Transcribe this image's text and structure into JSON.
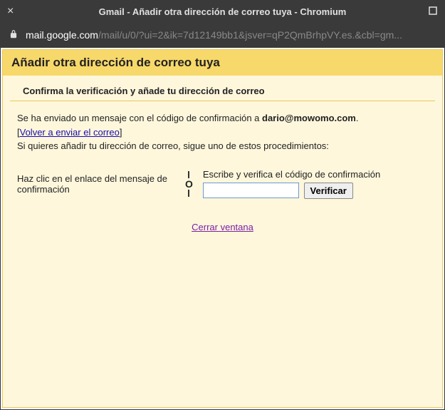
{
  "window": {
    "title": "Gmail - Añadir otra dirección de correo tuya - Chromium",
    "url_bright": "mail.google.com",
    "url_dim": "/mail/u/0/?ui=2&ik=7d12149bb1&jsver=qP2QmBrhpVY.es.&cbl=gm..."
  },
  "page": {
    "header": "Añadir otra dirección de correo tuya",
    "subhead": "Confirma la verificación y añade tu dirección de correo",
    "msg_prefix": "Se ha enviado un mensaje con el código de confirmación a ",
    "email": "dario@mowomo.com",
    "msg_suffix": ".",
    "resend_link": "Volver a enviar el correo",
    "instructions": "Si quieres añadir tu dirección de correo, sigue uno de estos procedimientos:",
    "option_left": "Haz clic en el enlace del mensaje de confirmación",
    "divider_label": "O",
    "option_right_label": "Escribe y verifica el código de confirmación",
    "verify_button": "Verificar",
    "close_link": "Cerrar ventana"
  }
}
